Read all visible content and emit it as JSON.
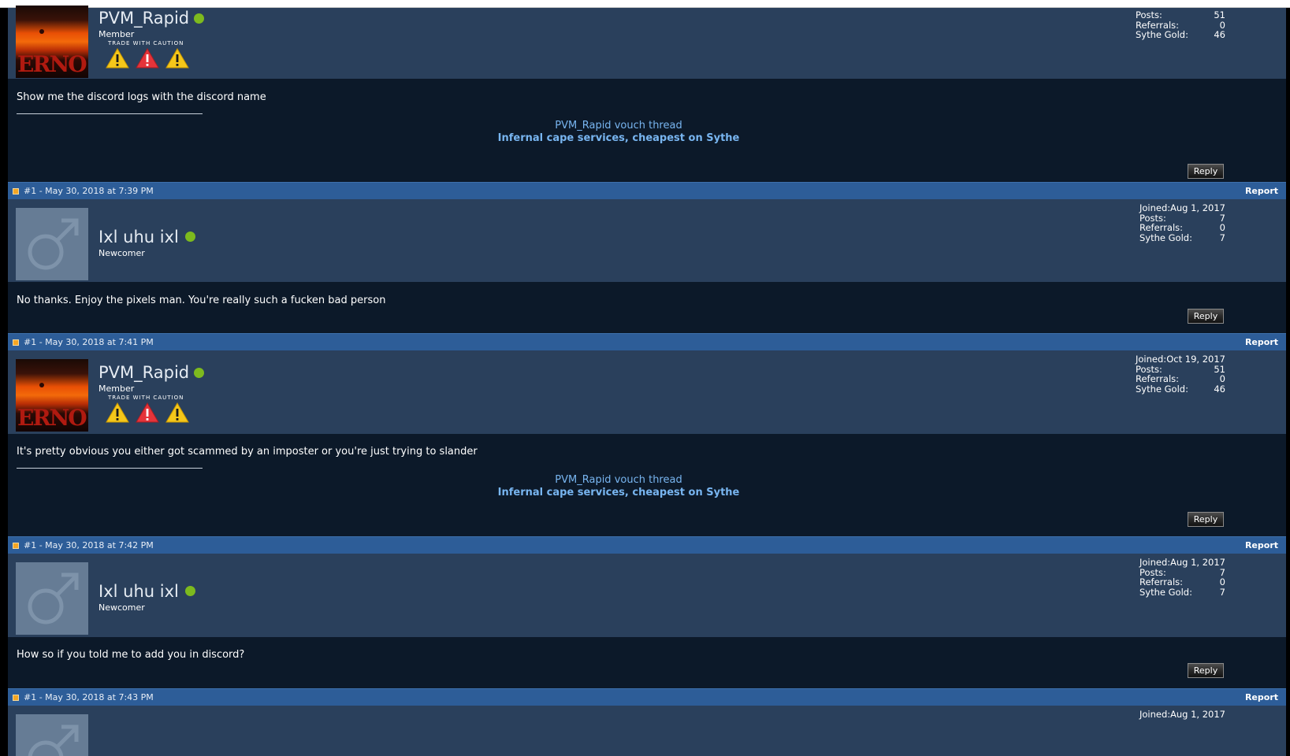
{
  "colors": {
    "page_bg": "#0c1929",
    "post_bar": "#2d5d98",
    "user_header": "#2a405c",
    "link": "#78b5f0",
    "online": "#7dba1e"
  },
  "stat_labels": {
    "joined": "Joined:",
    "posts": "Posts:",
    "referrals": "Referrals:",
    "gold": "Sythe Gold:"
  },
  "buttons": {
    "reply": "Reply",
    "report": "Report"
  },
  "icons": [
    "post-icon",
    "online-status-icon",
    "warning-icon",
    "default-male-avatar-icon"
  ],
  "posts": [
    {
      "username": "PVM_Rapid",
      "user_title": "Member",
      "caution_label": "Trade with caution",
      "stats": {
        "posts": "51",
        "referrals": "0",
        "gold": "46"
      },
      "message": "Show me the discord logs with the discord name",
      "signature": {
        "vouch_link": "PVM_Rapid vouch thread",
        "service_link": "Infernal cape services, cheapest on Sythe"
      }
    },
    {
      "post_meta": "#1 - May 30, 2018 at 7:39 PM",
      "username": "Ixl uhu ixl",
      "user_title": "Newcomer",
      "stats": {
        "joined": "Aug 1, 2017",
        "posts": "7",
        "referrals": "0",
        "gold": "7"
      },
      "message": "No thanks. Enjoy the pixels man. You're really such a fucken bad person"
    },
    {
      "post_meta": "#1 - May 30, 2018 at 7:41 PM",
      "username": "PVM_Rapid",
      "user_title": "Member",
      "caution_label": "Trade with caution",
      "stats": {
        "joined": "Oct 19, 2017",
        "posts": "51",
        "referrals": "0",
        "gold": "46"
      },
      "message": "It's pretty obvious you either got scammed by an imposter or you're just trying to slander",
      "signature": {
        "vouch_link": "PVM_Rapid vouch thread",
        "service_link": "Infernal cape services, cheapest on Sythe"
      }
    },
    {
      "post_meta": "#1 - May 30, 2018 at 7:42 PM",
      "username": "Ixl uhu ixl",
      "user_title": "Newcomer",
      "stats": {
        "joined": "Aug 1, 2017",
        "posts": "7",
        "referrals": "0",
        "gold": "7"
      },
      "message": "How so if you told me to add you in discord?"
    },
    {
      "post_meta": "#1 - May 30, 2018 at 7:43 PM",
      "stats": {
        "joined": "Aug 1, 2017"
      }
    }
  ]
}
